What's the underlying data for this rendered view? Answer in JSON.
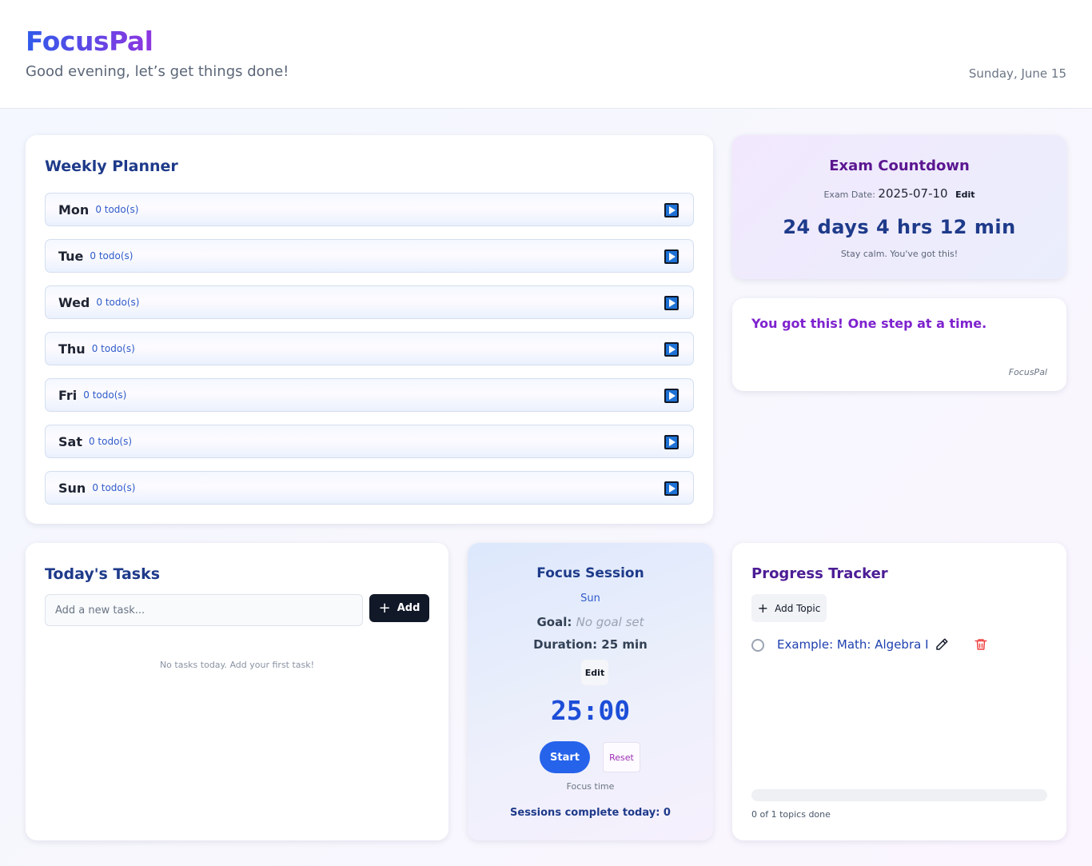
{
  "header": {
    "brand": "FocusPal",
    "greeting": "Good evening, let’s get things done!",
    "date": "Sunday, June 15"
  },
  "planner": {
    "title": "Weekly Planner",
    "days": [
      {
        "name": "Mon",
        "count": "0 todo(s)"
      },
      {
        "name": "Tue",
        "count": "0 todo(s)"
      },
      {
        "name": "Wed",
        "count": "0 todo(s)"
      },
      {
        "name": "Thu",
        "count": "0 todo(s)"
      },
      {
        "name": "Fri",
        "count": "0 todo(s)"
      },
      {
        "name": "Sat",
        "count": "0 todo(s)"
      },
      {
        "name": "Sun",
        "count": "0 todo(s)"
      }
    ]
  },
  "exam": {
    "title": "Exam Countdown",
    "date_label": "Exam Date:",
    "date_value": "2025-07-10",
    "edit_label": "Edit",
    "countdown": "24 days 4 hrs 12 min",
    "message": "Stay calm. You've got this!"
  },
  "motivation": {
    "quote": "You got this! One step at a time.",
    "source": "FocusPal"
  },
  "tasks": {
    "title": "Today's Tasks",
    "input_placeholder": "Add a new task...",
    "input_value": "",
    "add_label": "Add",
    "empty_message": "No tasks today. Add your first task!"
  },
  "focus": {
    "title": "Focus Session",
    "day": "Sun",
    "goal_label": "Goal:",
    "goal_value": "No goal set",
    "duration": "Duration: 25 min",
    "edit_label": "Edit",
    "timer": "25:00",
    "start_label": "Start",
    "reset_label": "Reset",
    "mode_label": "Focus time",
    "sessions": "Sessions complete today: 0"
  },
  "progress": {
    "title": "Progress Tracker",
    "add_topic_label": "Add Topic",
    "topics": [
      {
        "name": "Example: Math: Algebra I",
        "done": false
      }
    ],
    "completed_fraction": 0,
    "summary": "0 of 1 topics done"
  },
  "colors": {
    "brand_start": "#2f5bea",
    "brand_end": "#8e35e0",
    "accent_blue": "#2563eb",
    "accent_purple": "#7e22ce",
    "delete_red": "#ef4444"
  },
  "icons": {
    "day_toggle": "play-icon",
    "add": "plus-icon",
    "topic_status": "circle-icon",
    "topic_edit": "pencil-icon",
    "topic_delete": "trash-icon"
  }
}
